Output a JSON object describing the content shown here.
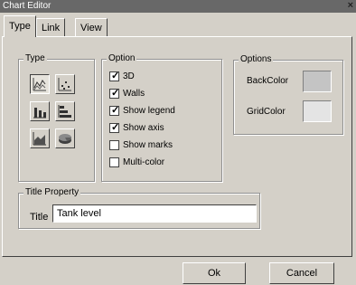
{
  "window": {
    "title": "Chart Editor",
    "close_glyph": "×"
  },
  "tabs": [
    {
      "label": "Type"
    },
    {
      "label": "Link"
    },
    {
      "label": "View"
    }
  ],
  "type_group": {
    "legend": "Type",
    "buttons": [
      {
        "icon": "line-chart-icon",
        "pressed": true
      },
      {
        "icon": "scatter-chart-icon",
        "pressed": false
      },
      {
        "icon": "bar-chart-icon",
        "pressed": false
      },
      {
        "icon": "horizontal-bar-chart-icon",
        "pressed": false
      },
      {
        "icon": "area-chart-icon",
        "pressed": false
      },
      {
        "icon": "pie-chart-icon",
        "pressed": false
      }
    ]
  },
  "option_group": {
    "legend": "Option",
    "items": [
      {
        "label": "3D",
        "checked": true
      },
      {
        "label": "Walls",
        "checked": true
      },
      {
        "label": "Show legend",
        "checked": true
      },
      {
        "label": "Show axis",
        "checked": true
      },
      {
        "label": "Show marks",
        "checked": false
      },
      {
        "label": "Multi-color",
        "checked": false
      }
    ]
  },
  "options_group": {
    "legend": "Options",
    "back_color_label": "BackColor",
    "grid_color_label": "GridColor",
    "back_color": "#c4c4c4",
    "grid_color": "#e4e4e4"
  },
  "title_property": {
    "legend": "Title Property",
    "label": "Title",
    "value": "Tank level"
  },
  "buttons": {
    "ok": "Ok",
    "cancel": "Cancel"
  }
}
